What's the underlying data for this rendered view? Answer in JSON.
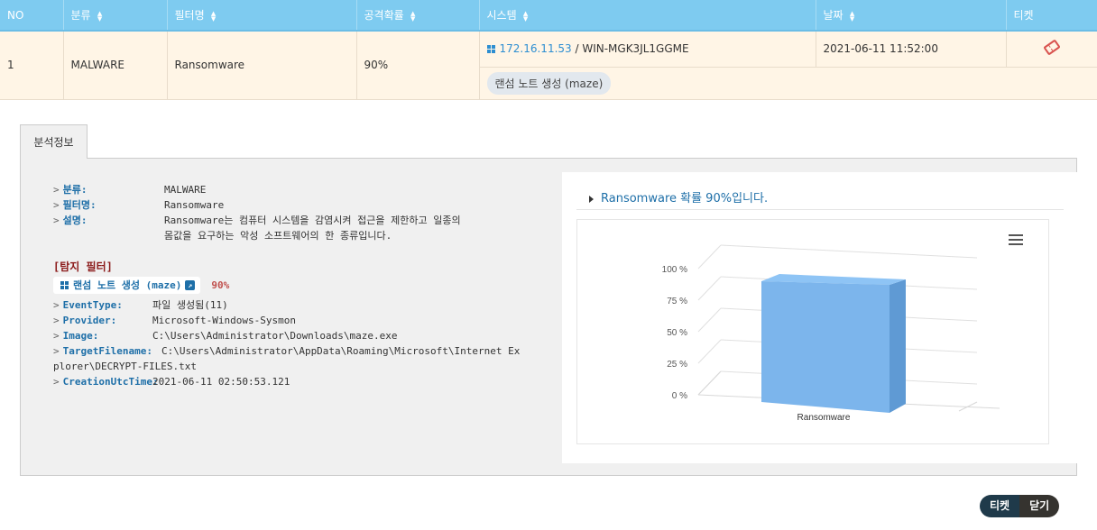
{
  "table": {
    "headers": [
      "NO",
      "분류",
      "필터명",
      "공격확률",
      "시스템",
      "날짜",
      "티켓"
    ],
    "row": {
      "no": "1",
      "category": "MALWARE",
      "filter": "Ransomware",
      "probability": "90%",
      "system_ip": "172.16.11.53",
      "system_sep": " / ",
      "system_host": "WIN-MGK3JL1GGME",
      "date": "2021-06-11 11:52:00",
      "sub_tag": "랜섬 노트 생성 (maze)"
    }
  },
  "tab": {
    "label": "분석정보"
  },
  "info": {
    "category_label": "분류:",
    "category_value": "MALWARE",
    "filter_label": "필터명:",
    "filter_value": "Ransomware",
    "desc_label": "설명:",
    "desc_line1": "Ransomware는 컴퓨터 시스템을 감염시켜 접근을 제한하고 일종의",
    "desc_line2": "몸값을 요구하는 악성 소프트웨어의 한 종류입니다."
  },
  "detection": {
    "title": "[탐지 필터]",
    "chip_label": "랜섬 노트 생성 (maze)",
    "chip_pct": "90%",
    "event_type_label": "EventType:",
    "event_type_value": "파일 생성됨(11)",
    "provider_label": "Provider:",
    "provider_value": "Microsoft-Windows-Sysmon",
    "image_label": "Image:",
    "image_value": "C:\\Users\\Administrator\\Downloads\\maze.exe",
    "target_label": "TargetFilename:",
    "target_value": "C:\\Users\\Administrator\\AppData\\Roaming\\Microsoft\\Internet Explorer\\DECRYPT-FILES.txt",
    "creation_label": "CreationUtcTime:",
    "creation_value": "2021-06-11 02:50:53.121"
  },
  "chart_card": {
    "title": "Ransomware 확률 90%입니다."
  },
  "chart_data": {
    "type": "bar",
    "categories": [
      "Ransomware"
    ],
    "values": [
      90
    ],
    "ylim": [
      0,
      100
    ],
    "yticks": [
      "0 %",
      "25 %",
      "50 %",
      "75 %",
      "100 %"
    ],
    "color": "#7cb5ec",
    "three_d": true,
    "grid": true
  },
  "footer": {
    "ticket_button": "티켓",
    "close_button": "닫기"
  },
  "colors": {
    "header_bg": "#7ecbf0",
    "row_bg": "#fff5e6",
    "accent_red": "#c0504d",
    "link_blue": "#2d8ed1"
  }
}
